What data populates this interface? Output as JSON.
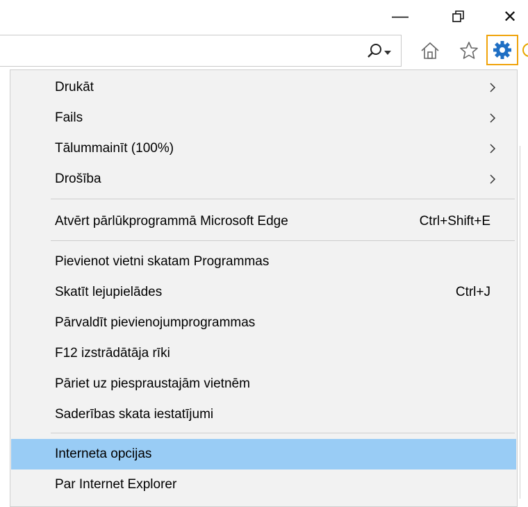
{
  "window": {
    "minimize_glyph": "—",
    "close_glyph": "✕"
  },
  "toolbar": {
    "icons": [
      "home-icon",
      "favorites-star-icon",
      "tools-gear-icon"
    ],
    "accent_color": "#f0a30a",
    "gear_color": "#1f6fc4"
  },
  "menu": {
    "highlight_color": "#99ccf5",
    "items": [
      {
        "label": "Drukāt",
        "submenu": true
      },
      {
        "label": "Fails",
        "submenu": true
      },
      {
        "label": "Tālummainīt (100%)",
        "submenu": true
      },
      {
        "label": "Drošība",
        "submenu": true
      },
      {
        "label": "Atvērt pārlūkprogrammā Microsoft Edge",
        "shortcut": "Ctrl+Shift+E"
      },
      {
        "label": "Pievienot vietni skatam Programmas"
      },
      {
        "label": "Skatīt lejupielādes",
        "shortcut": "Ctrl+J"
      },
      {
        "label": "Pārvaldīt pievienojumprogrammas"
      },
      {
        "label": "F12 izstrādātāja rīki"
      },
      {
        "label": "Pāriet uz piespraustajām vietnēm"
      },
      {
        "label": "Saderības skata iestatījumi"
      },
      {
        "label": "Interneta opcijas",
        "highlighted": true
      },
      {
        "label": "Par Internet Explorer"
      }
    ]
  }
}
